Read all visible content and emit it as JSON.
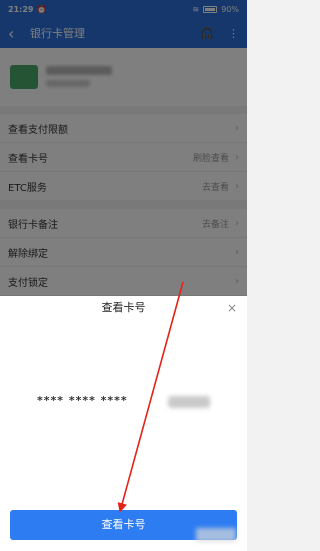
{
  "status": {
    "time": "21:29",
    "battery": "90%"
  },
  "nav": {
    "back": "‹",
    "title": "银行卡管理"
  },
  "menu": [
    {
      "label": "查看支付限额",
      "value": ""
    },
    {
      "label": "查看卡号",
      "value": "刷脸查看"
    },
    {
      "label": "ETC服务",
      "value": "去查看"
    },
    {
      "label": "银行卡备注",
      "value": "去备注"
    },
    {
      "label": "解除绑定",
      "value": ""
    },
    {
      "label": "支付锁定",
      "value": ""
    }
  ],
  "sheet": {
    "title": "查看卡号",
    "close": "×",
    "card_number_masked": "**** **** ****"
  },
  "button": {
    "label": "查看卡号"
  },
  "colors": {
    "primary": "#2a6fd8",
    "button": "#2d7cf1",
    "arrow": "#e2231a"
  }
}
